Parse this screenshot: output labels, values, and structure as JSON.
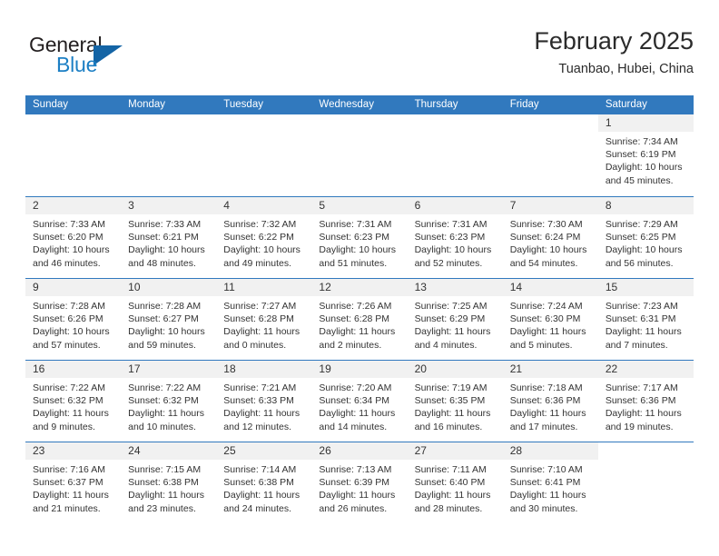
{
  "brand": {
    "word1": "General",
    "word2": "Blue",
    "flag_color": "#1464a5",
    "blue_color": "#1c7fc4"
  },
  "header": {
    "title": "February 2025",
    "subtitle": "Tuanbao, Hubei, China"
  },
  "theme": {
    "header_bg": "#3179be",
    "daynum_bg": "#f1f1f1",
    "row_divider": "#3179be",
    "text": "#333333"
  },
  "weekdays": [
    "Sunday",
    "Monday",
    "Tuesday",
    "Wednesday",
    "Thursday",
    "Friday",
    "Saturday"
  ],
  "weeks": [
    [
      {
        "empty": true
      },
      {
        "empty": true
      },
      {
        "empty": true
      },
      {
        "empty": true
      },
      {
        "empty": true
      },
      {
        "empty": true
      },
      {
        "day": "1",
        "sunrise": "Sunrise: 7:34 AM",
        "sunset": "Sunset: 6:19 PM",
        "daylight1": "Daylight: 10 hours",
        "daylight2": "and 45 minutes."
      }
    ],
    [
      {
        "day": "2",
        "sunrise": "Sunrise: 7:33 AM",
        "sunset": "Sunset: 6:20 PM",
        "daylight1": "Daylight: 10 hours",
        "daylight2": "and 46 minutes."
      },
      {
        "day": "3",
        "sunrise": "Sunrise: 7:33 AM",
        "sunset": "Sunset: 6:21 PM",
        "daylight1": "Daylight: 10 hours",
        "daylight2": "and 48 minutes."
      },
      {
        "day": "4",
        "sunrise": "Sunrise: 7:32 AM",
        "sunset": "Sunset: 6:22 PM",
        "daylight1": "Daylight: 10 hours",
        "daylight2": "and 49 minutes."
      },
      {
        "day": "5",
        "sunrise": "Sunrise: 7:31 AM",
        "sunset": "Sunset: 6:23 PM",
        "daylight1": "Daylight: 10 hours",
        "daylight2": "and 51 minutes."
      },
      {
        "day": "6",
        "sunrise": "Sunrise: 7:31 AM",
        "sunset": "Sunset: 6:23 PM",
        "daylight1": "Daylight: 10 hours",
        "daylight2": "and 52 minutes."
      },
      {
        "day": "7",
        "sunrise": "Sunrise: 7:30 AM",
        "sunset": "Sunset: 6:24 PM",
        "daylight1": "Daylight: 10 hours",
        "daylight2": "and 54 minutes."
      },
      {
        "day": "8",
        "sunrise": "Sunrise: 7:29 AM",
        "sunset": "Sunset: 6:25 PM",
        "daylight1": "Daylight: 10 hours",
        "daylight2": "and 56 minutes."
      }
    ],
    [
      {
        "day": "9",
        "sunrise": "Sunrise: 7:28 AM",
        "sunset": "Sunset: 6:26 PM",
        "daylight1": "Daylight: 10 hours",
        "daylight2": "and 57 minutes."
      },
      {
        "day": "10",
        "sunrise": "Sunrise: 7:28 AM",
        "sunset": "Sunset: 6:27 PM",
        "daylight1": "Daylight: 10 hours",
        "daylight2": "and 59 minutes."
      },
      {
        "day": "11",
        "sunrise": "Sunrise: 7:27 AM",
        "sunset": "Sunset: 6:28 PM",
        "daylight1": "Daylight: 11 hours",
        "daylight2": "and 0 minutes."
      },
      {
        "day": "12",
        "sunrise": "Sunrise: 7:26 AM",
        "sunset": "Sunset: 6:28 PM",
        "daylight1": "Daylight: 11 hours",
        "daylight2": "and 2 minutes."
      },
      {
        "day": "13",
        "sunrise": "Sunrise: 7:25 AM",
        "sunset": "Sunset: 6:29 PM",
        "daylight1": "Daylight: 11 hours",
        "daylight2": "and 4 minutes."
      },
      {
        "day": "14",
        "sunrise": "Sunrise: 7:24 AM",
        "sunset": "Sunset: 6:30 PM",
        "daylight1": "Daylight: 11 hours",
        "daylight2": "and 5 minutes."
      },
      {
        "day": "15",
        "sunrise": "Sunrise: 7:23 AM",
        "sunset": "Sunset: 6:31 PM",
        "daylight1": "Daylight: 11 hours",
        "daylight2": "and 7 minutes."
      }
    ],
    [
      {
        "day": "16",
        "sunrise": "Sunrise: 7:22 AM",
        "sunset": "Sunset: 6:32 PM",
        "daylight1": "Daylight: 11 hours",
        "daylight2": "and 9 minutes."
      },
      {
        "day": "17",
        "sunrise": "Sunrise: 7:22 AM",
        "sunset": "Sunset: 6:32 PM",
        "daylight1": "Daylight: 11 hours",
        "daylight2": "and 10 minutes."
      },
      {
        "day": "18",
        "sunrise": "Sunrise: 7:21 AM",
        "sunset": "Sunset: 6:33 PM",
        "daylight1": "Daylight: 11 hours",
        "daylight2": "and 12 minutes."
      },
      {
        "day": "19",
        "sunrise": "Sunrise: 7:20 AM",
        "sunset": "Sunset: 6:34 PM",
        "daylight1": "Daylight: 11 hours",
        "daylight2": "and 14 minutes."
      },
      {
        "day": "20",
        "sunrise": "Sunrise: 7:19 AM",
        "sunset": "Sunset: 6:35 PM",
        "daylight1": "Daylight: 11 hours",
        "daylight2": "and 16 minutes."
      },
      {
        "day": "21",
        "sunrise": "Sunrise: 7:18 AM",
        "sunset": "Sunset: 6:36 PM",
        "daylight1": "Daylight: 11 hours",
        "daylight2": "and 17 minutes."
      },
      {
        "day": "22",
        "sunrise": "Sunrise: 7:17 AM",
        "sunset": "Sunset: 6:36 PM",
        "daylight1": "Daylight: 11 hours",
        "daylight2": "and 19 minutes."
      }
    ],
    [
      {
        "day": "23",
        "sunrise": "Sunrise: 7:16 AM",
        "sunset": "Sunset: 6:37 PM",
        "daylight1": "Daylight: 11 hours",
        "daylight2": "and 21 minutes."
      },
      {
        "day": "24",
        "sunrise": "Sunrise: 7:15 AM",
        "sunset": "Sunset: 6:38 PM",
        "daylight1": "Daylight: 11 hours",
        "daylight2": "and 23 minutes."
      },
      {
        "day": "25",
        "sunrise": "Sunrise: 7:14 AM",
        "sunset": "Sunset: 6:38 PM",
        "daylight1": "Daylight: 11 hours",
        "daylight2": "and 24 minutes."
      },
      {
        "day": "26",
        "sunrise": "Sunrise: 7:13 AM",
        "sunset": "Sunset: 6:39 PM",
        "daylight1": "Daylight: 11 hours",
        "daylight2": "and 26 minutes."
      },
      {
        "day": "27",
        "sunrise": "Sunrise: 7:11 AM",
        "sunset": "Sunset: 6:40 PM",
        "daylight1": "Daylight: 11 hours",
        "daylight2": "and 28 minutes."
      },
      {
        "day": "28",
        "sunrise": "Sunrise: 7:10 AM",
        "sunset": "Sunset: 6:41 PM",
        "daylight1": "Daylight: 11 hours",
        "daylight2": "and 30 minutes."
      },
      {
        "empty": true
      }
    ]
  ]
}
